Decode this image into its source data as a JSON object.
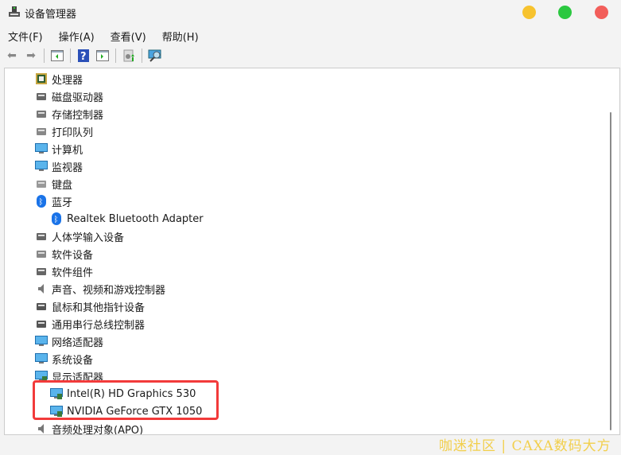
{
  "window": {
    "title": "设备管理器",
    "colors": {
      "minimize": "#f7c32e",
      "maximize": "#2bc840",
      "close": "#f25e5a"
    }
  },
  "menu": [
    "文件(F)",
    "操作(A)",
    "查看(V)",
    "帮助(H)"
  ],
  "toolbar": [
    "back-icon",
    "forward-icon",
    "show-hide-console-tree-icon",
    "help-icon",
    "action-pane-icon",
    "update-driver-icon",
    "scan-hardware-icon"
  ],
  "tree": [
    {
      "label": "处理器",
      "icon": "processor-icon",
      "level": 0
    },
    {
      "label": "磁盘驱动器",
      "icon": "disk-drive-icon",
      "level": 0
    },
    {
      "label": "存储控制器",
      "icon": "storage-controller-icon",
      "level": 0
    },
    {
      "label": "打印队列",
      "icon": "printer-icon",
      "level": 0
    },
    {
      "label": "计算机",
      "icon": "computer-icon",
      "level": 0
    },
    {
      "label": "监视器",
      "icon": "monitor-icon",
      "level": 0
    },
    {
      "label": "键盘",
      "icon": "keyboard-icon",
      "level": 0
    },
    {
      "label": "蓝牙",
      "icon": "bluetooth-icon",
      "level": 0,
      "expanded": true
    },
    {
      "label": "Realtek Bluetooth Adapter",
      "icon": "bluetooth-device-icon",
      "level": 1
    },
    {
      "label": "人体学输入设备",
      "icon": "hid-icon",
      "level": 0
    },
    {
      "label": "软件设备",
      "icon": "software-device-icon",
      "level": 0
    },
    {
      "label": "软件组件",
      "icon": "software-component-icon",
      "level": 0
    },
    {
      "label": "声音、视频和游戏控制器",
      "icon": "speaker-icon",
      "level": 0
    },
    {
      "label": "鼠标和其他指针设备",
      "icon": "mouse-icon",
      "level": 0
    },
    {
      "label": "通用串行总线控制器",
      "icon": "usb-icon",
      "level": 0
    },
    {
      "label": "网络适配器",
      "icon": "network-icon",
      "level": 0
    },
    {
      "label": "系统设备",
      "icon": "system-device-icon",
      "level": 0
    },
    {
      "label": "显示适配器",
      "icon": "display-adapter-icon",
      "level": 0,
      "expanded": true
    },
    {
      "label": "Intel(R) HD Graphics 530",
      "icon": "display-adapter-icon",
      "level": 1
    },
    {
      "label": "NVIDIA GeForce GTX 1050",
      "icon": "display-adapter-icon",
      "level": 1
    },
    {
      "label": "音频处理对象(APO)",
      "icon": "speaker-icon",
      "level": 0
    }
  ],
  "watermark": "咖迷社区 | CAXA数码大方"
}
